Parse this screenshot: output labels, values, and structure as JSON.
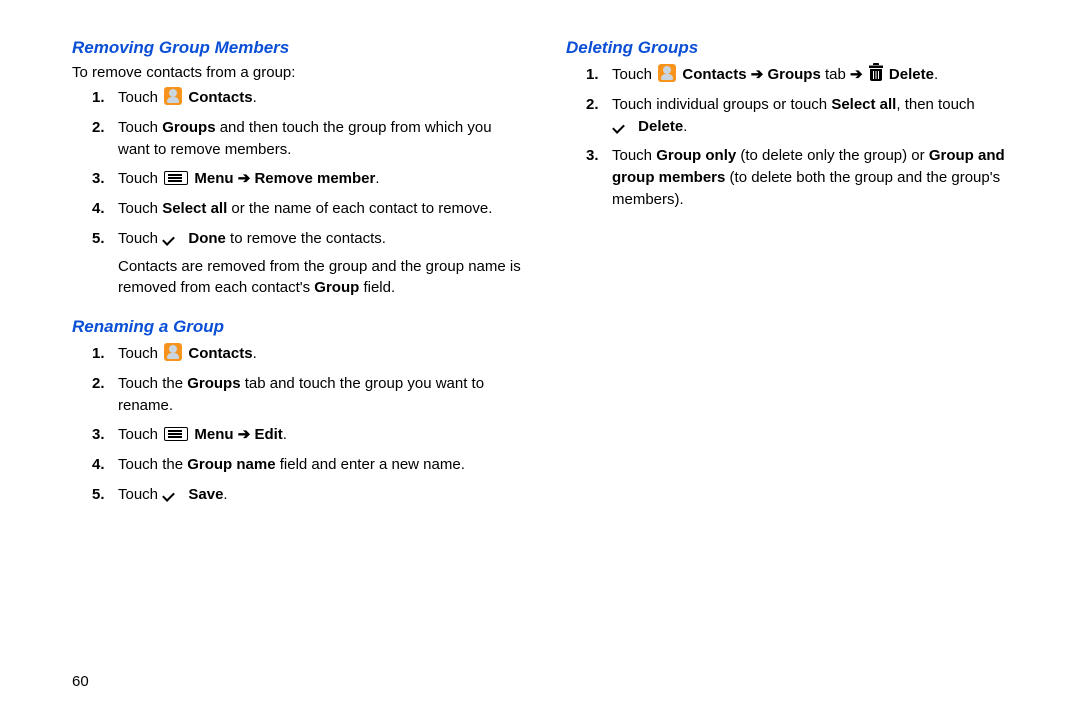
{
  "page_number": "60",
  "left": {
    "section1": {
      "title": "Removing Group Members",
      "intro": "To remove contacts from a group:",
      "s1_touch": "Touch ",
      "s1_contacts": "Contacts",
      "s1_period": ".",
      "s2_a": "Touch ",
      "s2_b": "Groups",
      "s2_c": " and then touch the group from which you want to remove members.",
      "s3_a": "Touch ",
      "s3_b": "Menu",
      "s3_arrow": " ➔ ",
      "s3_c": "Remove member",
      "s3_d": ".",
      "s4_a": "Touch ",
      "s4_b": "Select all",
      "s4_c": " or the name of each contact to remove.",
      "s5_a": "Touch ",
      "s5_b": "Done",
      "s5_c": " to remove the contacts.",
      "note_a": "Contacts are removed from the group and the group name is removed from each contact's ",
      "note_b": "Group",
      "note_c": " field."
    },
    "section2": {
      "title": "Renaming a Group",
      "s1_touch": "Touch ",
      "s1_contacts": "Contacts",
      "s1_period": ".",
      "s2_a": "Touch the ",
      "s2_b": "Groups",
      "s2_c": " tab and touch the group you want to rename.",
      "s3_a": "Touch ",
      "s3_b": "Menu",
      "s3_arrow": " ➔ ",
      "s3_c": "Edit",
      "s3_d": ".",
      "s4_a": "Touch the ",
      "s4_b": "Group name",
      "s4_c": " field and enter a new name.",
      "s5_a": "Touch ",
      "s5_b": "Save",
      "s5_c": "."
    }
  },
  "right": {
    "section1": {
      "title": "Deleting Groups",
      "s1_touch": "Touch ",
      "s1_contacts": "Contacts",
      "s1_arrow1": " ➔ ",
      "s1_groups": "Groups",
      "s1_tab": " tab",
      "s1_arrow2": " ➔ ",
      "s1_delete": "Delete",
      "s1_period": ".",
      "s2_a": "Touch individual groups or touch ",
      "s2_b": "Select all",
      "s2_c": ", then touch ",
      "s2_d": "Delete",
      "s2_e": ".",
      "s3_a": "Touch ",
      "s3_b": "Group only",
      "s3_c": " (to delete only the group) or ",
      "s3_d": "Group and group members",
      "s3_e": " (to delete both the group and the group's members)."
    }
  }
}
